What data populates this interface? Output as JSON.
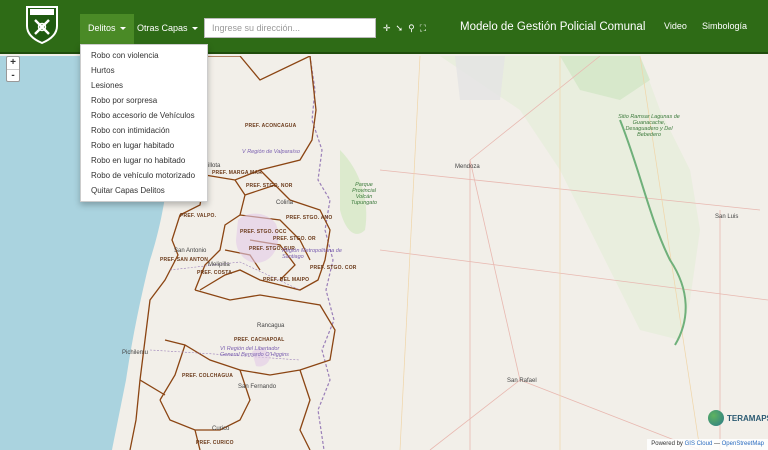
{
  "header": {
    "nav": [
      {
        "label": "Delitos",
        "active": true
      },
      {
        "label": "Otras Capas",
        "active": false
      }
    ],
    "search_placeholder": "Ingrese su dirección...",
    "title": "Modelo de Gestión Policial Comunal",
    "right_links": [
      "Video",
      "Simbología"
    ],
    "tool_icons": [
      "crosshair-icon",
      "pointer-icon",
      "search-tool-icon",
      "expand-icon"
    ]
  },
  "delitos_menu": [
    "Robo con violencia",
    "Hurtos",
    "Lesiones",
    "Robo por sorpresa",
    "Robo accesorio de Vehículos",
    "Robo con intimidación",
    "Robo en lugar habitado",
    "Robo en lugar no habitado",
    "Robo de vehículo motorizado",
    "Quitar Capas Delitos"
  ],
  "map": {
    "zoom_in": "+",
    "zoom_out": "-",
    "prefecture_labels": [
      "PREF. ACONCAGUA",
      "PREF. MARGA MAR",
      "PREF. STGO. NOR",
      "PREF. STGO. ANO",
      "PREF. VALPO.",
      "PREF. STGO. OCC",
      "PREF. STGO. OR",
      "PREF. STGO. SUR",
      "PREF. SAN ANTON",
      "PREF. STGO. COR",
      "PREF. COSTA",
      "PREF. DEL MAIPO",
      "PREF. CACHAPOAL",
      "PREF. COLCHAGUA",
      "PREF. CURICO"
    ],
    "region_labels": [
      "V Región de Valparaíso",
      "Región Metropolitana de Santiago",
      "VI Región del Libertador General Bernardo O'Higgins"
    ],
    "city_labels": [
      "Quillota",
      "Colina",
      "San Antonio",
      "Melipilla",
      "Rancagua",
      "Pichilemu",
      "San Fernando",
      "Curicó",
      "Mendoza",
      "San Luis",
      "San Rafael"
    ],
    "park_labels": [
      "Parque Provincial Volcán Tupungato",
      "Sitio Ramsar Lagunas de Guanacache, Desaguadero y Del Bebedero"
    ],
    "brand": "TERAMAPS",
    "attribution": {
      "prefix": "Powered by",
      "link1": "GIS Cloud",
      "sep": "—",
      "link2": "OpenStreetMap"
    }
  },
  "colors": {
    "navbar": "#2e6b16",
    "prefecture_border": "#8b4513",
    "sea": "#aad3df",
    "land": "#f2efe9"
  }
}
